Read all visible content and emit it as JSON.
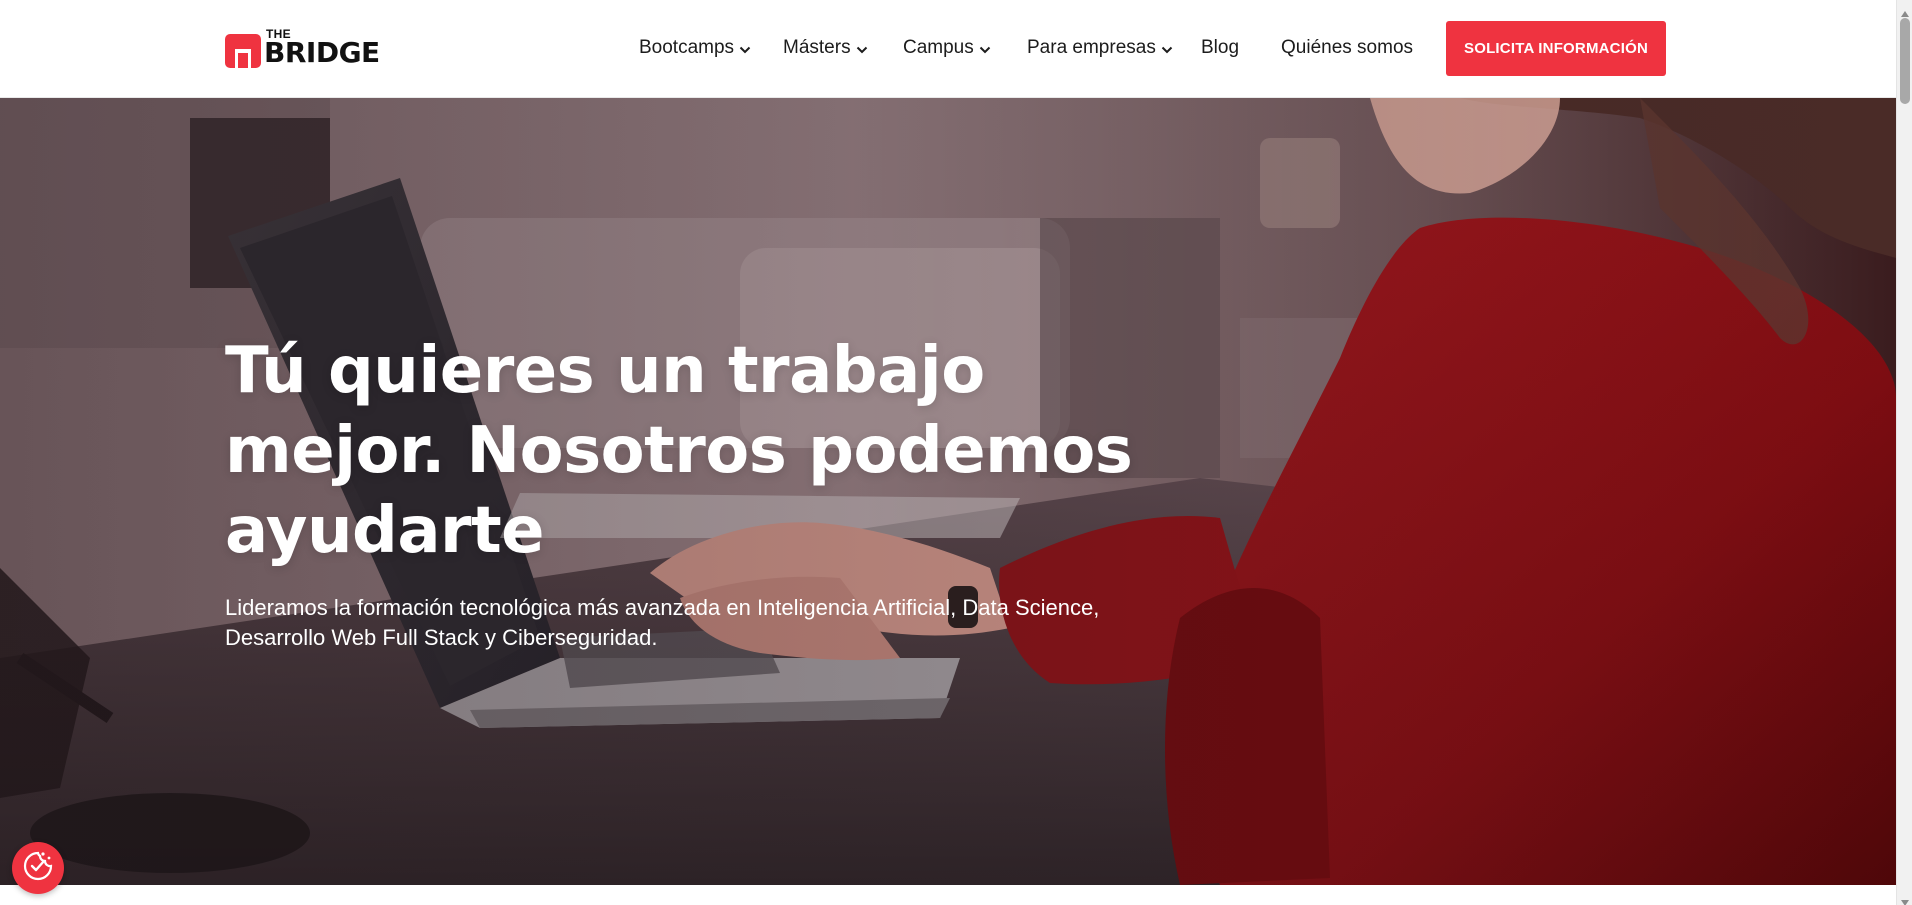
{
  "brand": {
    "logo_small": "THE",
    "logo_large": "BRIDGE",
    "accent_color": "#ef3340"
  },
  "nav": {
    "items": [
      {
        "label": "Bootcamps",
        "has_dropdown": true,
        "icon": "chevron-down-icon"
      },
      {
        "label": "Másters",
        "has_dropdown": true,
        "icon": "chevron-down-icon"
      },
      {
        "label": "Campus",
        "has_dropdown": true,
        "icon": "chevron-down-icon"
      },
      {
        "label": "Para empresas",
        "has_dropdown": true,
        "icon": "chevron-down-icon"
      },
      {
        "label": "Blog",
        "has_dropdown": false
      },
      {
        "label": "Quiénes somos",
        "has_dropdown": false
      }
    ],
    "cta_label": "SOLICITA INFORMACIÓN"
  },
  "hero": {
    "title_line1": "Tú quieres un trabajo",
    "title_line2": "mejor. Nosotros podemos",
    "title_line3": "ayudarte",
    "subtitle_line1": "Lideramos la formación tecnológica más avanzada en Inteligencia Artificial, Data Science,",
    "subtitle_line2": "Desarrollo Web Full Stack y Ciberseguridad.",
    "background_image": "woman-typing-on-laptop"
  },
  "consent": {
    "icon": "cookie-consent-icon",
    "color": "#ef3340"
  }
}
